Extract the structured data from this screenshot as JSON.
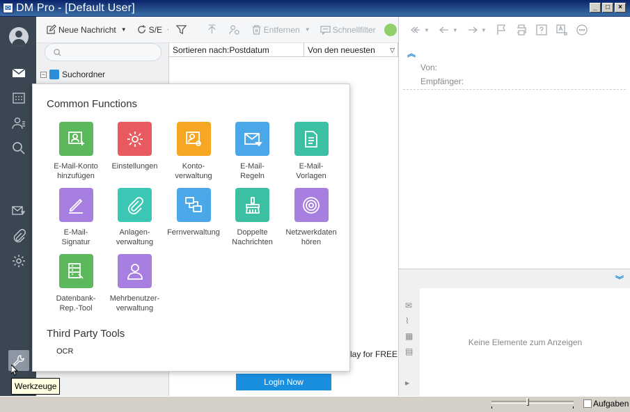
{
  "window": {
    "title": "DM Pro - [Default User]",
    "app_icon": "envelope-icon",
    "controls": [
      "_",
      "□",
      "×"
    ]
  },
  "sidebar": {
    "items": [
      "avatar",
      "mail-icon",
      "calendar-icon",
      "contacts-icon",
      "search-icon",
      "mail-filter-icon",
      "attachment-icon",
      "settings-icon"
    ],
    "tools_tooltip": "Werkzeuge"
  },
  "toolbar": {
    "new_message": "Neue Nachricht",
    "send_receive": "S/E",
    "remove": "Entfernen",
    "quick_filter": "Schnellfilter"
  },
  "folders": {
    "search_folder": "Suchordner"
  },
  "message_list": {
    "sort_by": "Sortieren nach:Postdatum",
    "sort_order": "Von den neuesten",
    "promo_text": "lay for FREE",
    "login_button": "Login Now"
  },
  "reader": {
    "from_label": "Von:",
    "to_label": "Empfänger:",
    "empty_text": "Keine Elemente zum Anzeigen"
  },
  "statusbar": {
    "tasks_label": "Aufgaben"
  },
  "popup": {
    "common_title": "Common Functions",
    "third_party_title": "Third Party Tools",
    "tiles": [
      {
        "label": "E-Mail-Konto\nhinzufügen",
        "color": "#5cb85c",
        "icon": "add-account-icon"
      },
      {
        "label": "Einstellungen",
        "color": "#e85a5f",
        "icon": "gear-icon"
      },
      {
        "label": "Konto-\nverwaltung",
        "color": "#f5a623",
        "icon": "account-settings-icon"
      },
      {
        "label": "E-Mail-\nRegeln",
        "color": "#4aa8e8",
        "icon": "mail-rules-icon"
      },
      {
        "label": "E-Mail-\nVorlagen",
        "color": "#3cbfa2",
        "icon": "template-icon"
      },
      {
        "label": "E-Mail-\nSignatur",
        "color": "#a77fe0",
        "icon": "signature-icon"
      },
      {
        "label": "Anlagen-\nverwaltung",
        "color": "#3cc7b5",
        "icon": "paperclip-icon"
      },
      {
        "label": "Fernverwaltung",
        "color": "#4aa8e8",
        "icon": "remote-icon"
      },
      {
        "label": "Doppelte\nNachrichten",
        "color": "#3cbfa2",
        "icon": "broom-icon"
      },
      {
        "label": "Netzwerkdaten\nhören",
        "color": "#a77fe0",
        "icon": "network-icon"
      },
      {
        "label": "Datenbank-\nRep.-Tool",
        "color": "#5cb85c",
        "icon": "database-repair-icon"
      },
      {
        "label": "Mehrbenutzer-\nverwaltung",
        "color": "#a77fe0",
        "icon": "multi-user-icon"
      }
    ],
    "third_party": [
      "OCR"
    ]
  }
}
